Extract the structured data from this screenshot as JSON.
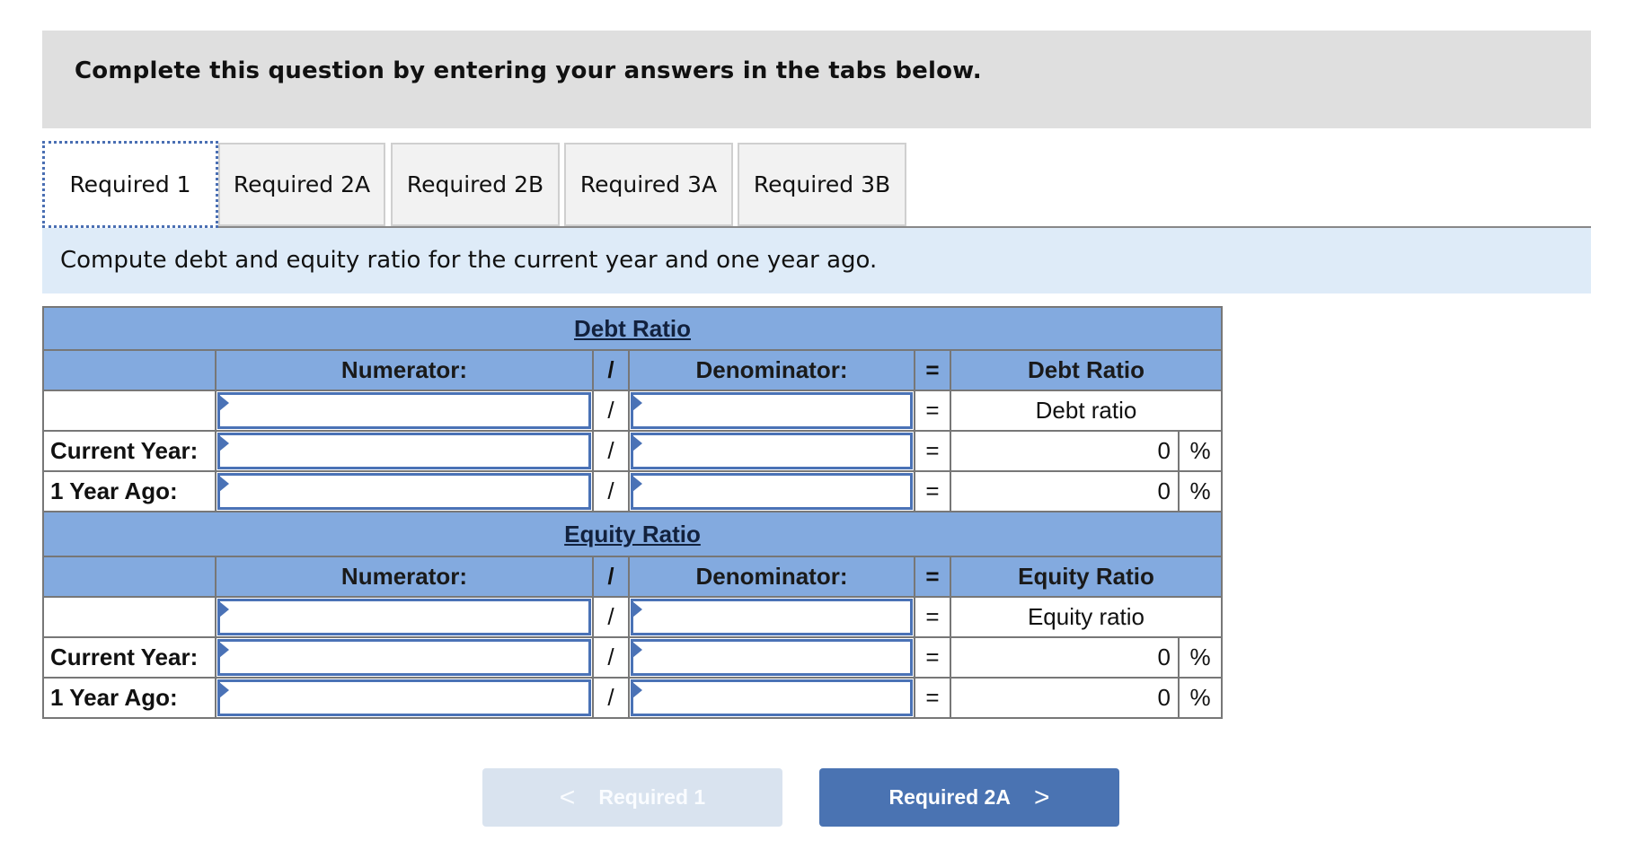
{
  "header": {
    "title": "Complete this question by entering your answers in the tabs below."
  },
  "tabs": [
    {
      "label": "Required 1",
      "active": true
    },
    {
      "label": "Required 2A",
      "active": false
    },
    {
      "label": "Required 2B",
      "active": false
    },
    {
      "label": "Required 3A",
      "active": false
    },
    {
      "label": "Required 3B",
      "active": false
    }
  ],
  "instruction": "Compute debt and equity ratio for the current year and one year ago.",
  "debt": {
    "title": "Debt Ratio",
    "numerator_label": "Numerator:",
    "divide": "/",
    "denominator_label": "Denominator:",
    "equals": "=",
    "result_header": "Debt Ratio",
    "result_subheader": "Debt ratio",
    "rows": [
      {
        "label": "",
        "numerator": "",
        "denominator": "",
        "result": "",
        "unit": ""
      },
      {
        "label": "Current Year:",
        "numerator": "",
        "denominator": "",
        "result": "0",
        "unit": "%"
      },
      {
        "label": "1 Year Ago:",
        "numerator": "",
        "denominator": "",
        "result": "0",
        "unit": "%"
      }
    ]
  },
  "equity": {
    "title": "Equity Ratio",
    "numerator_label": "Numerator:",
    "divide": "/",
    "denominator_label": "Denominator:",
    "equals": "=",
    "result_header": "Equity Ratio",
    "result_subheader": "Equity ratio",
    "rows": [
      {
        "label": "",
        "numerator": "",
        "denominator": "",
        "result": "",
        "unit": ""
      },
      {
        "label": "Current Year:",
        "numerator": "",
        "denominator": "",
        "result": "0",
        "unit": "%"
      },
      {
        "label": "1 Year Ago:",
        "numerator": "",
        "denominator": "",
        "result": "0",
        "unit": "%"
      }
    ]
  },
  "nav": {
    "prev_label": "Required 1",
    "prev_icon": "<",
    "prev_disabled": true,
    "next_label": "Required 2A",
    "next_icon": ">"
  }
}
